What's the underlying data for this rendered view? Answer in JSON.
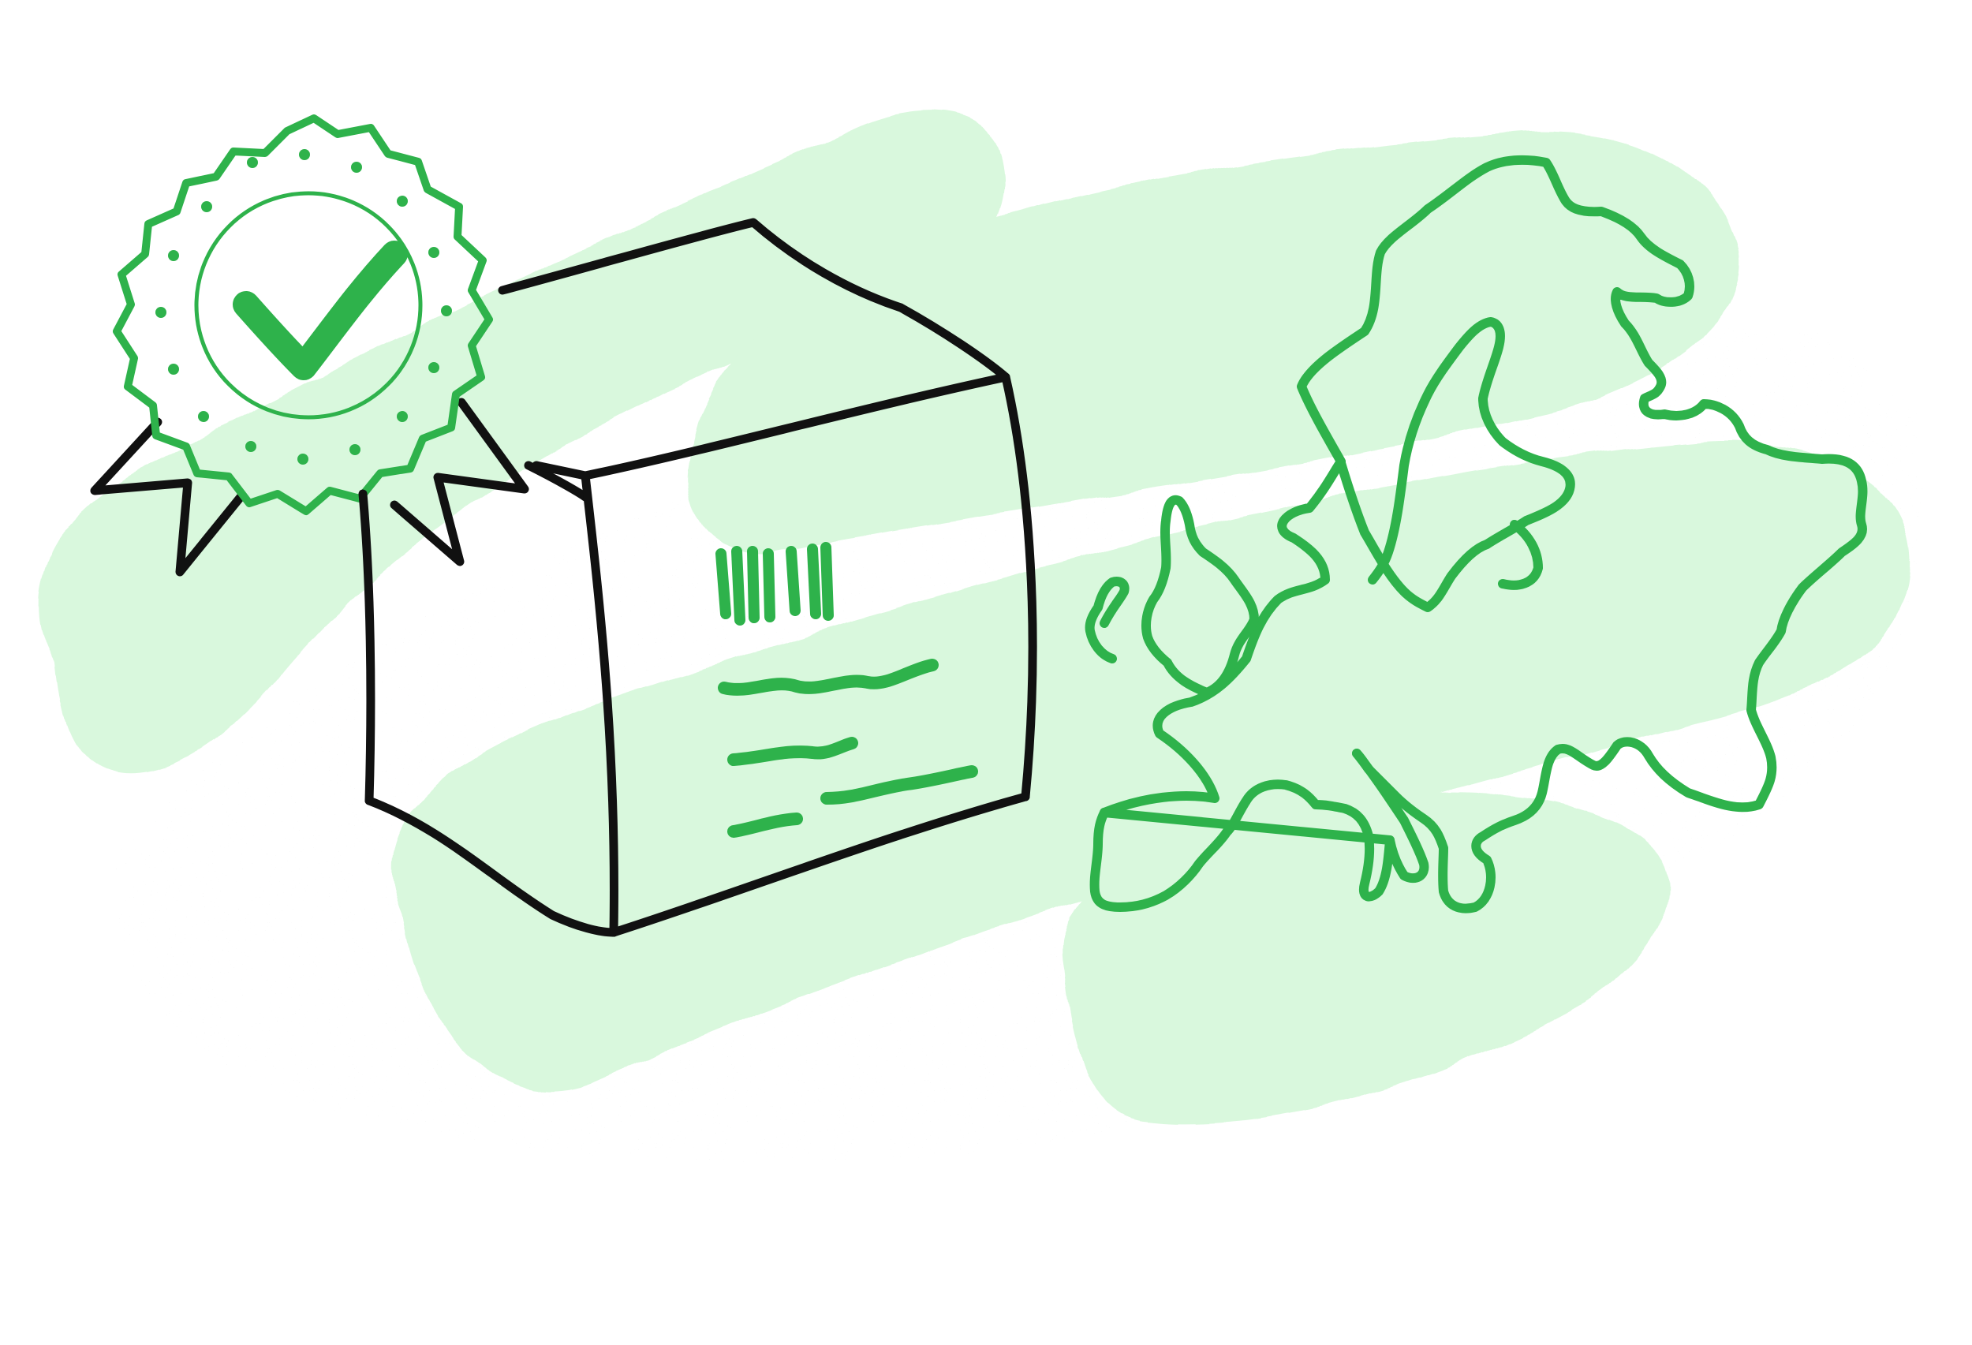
{
  "illustration": {
    "colors": {
      "background": "#ffffff",
      "brush_wash": "#d9f8dd",
      "accent_green": "#2eb24b",
      "ink_black": "#111111",
      "speckle": "#a9b6ad"
    },
    "elements": [
      {
        "name": "badge",
        "icon": "award-ribbon-icon"
      },
      {
        "name": "check",
        "icon": "checkmark-icon"
      },
      {
        "name": "package",
        "icon": "box-icon"
      },
      {
        "name": "barcode",
        "icon": "barcode-icon"
      },
      {
        "name": "map",
        "icon": "europe-map-icon"
      }
    ]
  }
}
